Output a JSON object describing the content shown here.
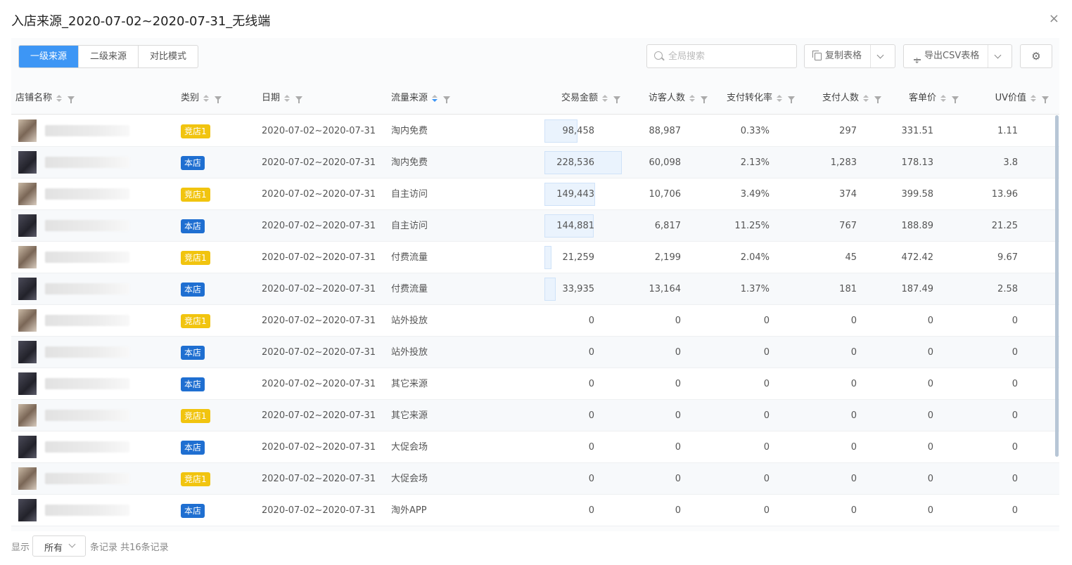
{
  "dialog": {
    "title": "入店来源_2020-07-02~2020-07-31_无线端",
    "close_icon": "×"
  },
  "toolbar": {
    "tabs": [
      {
        "label": "一级来源",
        "active": true
      },
      {
        "label": "二级来源",
        "active": false
      },
      {
        "label": "对比模式",
        "active": false
      }
    ],
    "search_placeholder": "全局搜索",
    "copy_label": "复制表格",
    "export_label": "导出CSV表格",
    "settings_icon": "gear-icon"
  },
  "table": {
    "columns": {
      "shop": "店铺名称",
      "type": "类别",
      "date": "日期",
      "source": "流量来源",
      "amount": "交易金额",
      "visitors": "访客人数",
      "conversion": "支付转化率",
      "buyers": "支付人数",
      "unit_price": "客单价",
      "uv_value": "UV价值"
    },
    "sorted_column": "source",
    "colors": {
      "own": "#1f6fd1",
      "competitor": "#f1c40f",
      "accent": "#3d96f5"
    },
    "rows": [
      {
        "avatar": "a",
        "type": "竞店1",
        "kind": "competitor",
        "date": "2020-07-02~2020-07-31",
        "source": "淘内免费",
        "amount": "98,458",
        "amount_value": 98458,
        "visitors": "88,987",
        "conversion": "0.33%",
        "buyers": "297",
        "unit_price": "331.51",
        "uv_value": "1.11"
      },
      {
        "avatar": "b",
        "type": "本店",
        "kind": "own",
        "date": "2020-07-02~2020-07-31",
        "source": "淘内免费",
        "amount": "228,536",
        "amount_value": 228536,
        "visitors": "60,098",
        "conversion": "2.13%",
        "buyers": "1,283",
        "unit_price": "178.13",
        "uv_value": "3.8"
      },
      {
        "avatar": "a",
        "type": "竞店1",
        "kind": "competitor",
        "date": "2020-07-02~2020-07-31",
        "source": "自主访问",
        "amount": "149,443",
        "amount_value": 149443,
        "visitors": "10,706",
        "conversion": "3.49%",
        "buyers": "374",
        "unit_price": "399.58",
        "uv_value": "13.96"
      },
      {
        "avatar": "b",
        "type": "本店",
        "kind": "own",
        "date": "2020-07-02~2020-07-31",
        "source": "自主访问",
        "amount": "144,881",
        "amount_value": 144881,
        "visitors": "6,817",
        "conversion": "11.25%",
        "buyers": "767",
        "unit_price": "188.89",
        "uv_value": "21.25"
      },
      {
        "avatar": "a",
        "type": "竞店1",
        "kind": "competitor",
        "date": "2020-07-02~2020-07-31",
        "source": "付费流量",
        "amount": "21,259",
        "amount_value": 21259,
        "visitors": "2,199",
        "conversion": "2.04%",
        "buyers": "45",
        "unit_price": "472.42",
        "uv_value": "9.67"
      },
      {
        "avatar": "b",
        "type": "本店",
        "kind": "own",
        "date": "2020-07-02~2020-07-31",
        "source": "付费流量",
        "amount": "33,935",
        "amount_value": 33935,
        "visitors": "13,164",
        "conversion": "1.37%",
        "buyers": "181",
        "unit_price": "187.49",
        "uv_value": "2.58"
      },
      {
        "avatar": "a",
        "type": "竞店1",
        "kind": "competitor",
        "date": "2020-07-02~2020-07-31",
        "source": "站外投放",
        "amount": "0",
        "amount_value": 0,
        "visitors": "0",
        "conversion": "0",
        "buyers": "0",
        "unit_price": "0",
        "uv_value": "0"
      },
      {
        "avatar": "b",
        "type": "本店",
        "kind": "own",
        "date": "2020-07-02~2020-07-31",
        "source": "站外投放",
        "amount": "0",
        "amount_value": 0,
        "visitors": "0",
        "conversion": "0",
        "buyers": "0",
        "unit_price": "0",
        "uv_value": "0"
      },
      {
        "avatar": "b",
        "type": "本店",
        "kind": "own",
        "date": "2020-07-02~2020-07-31",
        "source": "其它来源",
        "amount": "0",
        "amount_value": 0,
        "visitors": "0",
        "conversion": "0",
        "buyers": "0",
        "unit_price": "0",
        "uv_value": "0"
      },
      {
        "avatar": "a",
        "type": "竞店1",
        "kind": "competitor",
        "date": "2020-07-02~2020-07-31",
        "source": "其它来源",
        "amount": "0",
        "amount_value": 0,
        "visitors": "0",
        "conversion": "0",
        "buyers": "0",
        "unit_price": "0",
        "uv_value": "0"
      },
      {
        "avatar": "b",
        "type": "本店",
        "kind": "own",
        "date": "2020-07-02~2020-07-31",
        "source": "大促会场",
        "amount": "0",
        "amount_value": 0,
        "visitors": "0",
        "conversion": "0",
        "buyers": "0",
        "unit_price": "0",
        "uv_value": "0"
      },
      {
        "avatar": "a",
        "type": "竞店1",
        "kind": "competitor",
        "date": "2020-07-02~2020-07-31",
        "source": "大促会场",
        "amount": "0",
        "amount_value": 0,
        "visitors": "0",
        "conversion": "0",
        "buyers": "0",
        "unit_price": "0",
        "uv_value": "0"
      },
      {
        "avatar": "b",
        "type": "本店",
        "kind": "own",
        "date": "2020-07-02~2020-07-31",
        "source": "淘外APP",
        "amount": "0",
        "amount_value": 0,
        "visitors": "0",
        "conversion": "0",
        "buyers": "0",
        "unit_price": "0",
        "uv_value": "0"
      }
    ]
  },
  "footer": {
    "show_label": "显示",
    "page_size": "所有",
    "total_text": "条记录 共16条记录"
  }
}
